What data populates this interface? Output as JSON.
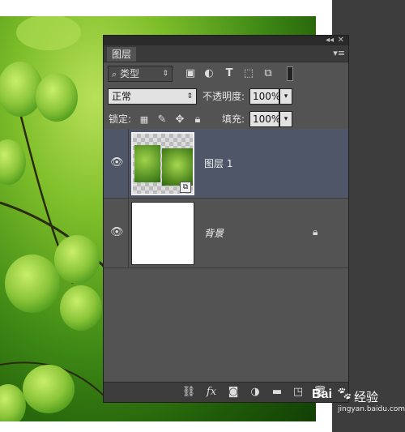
{
  "panel": {
    "tab_label": "图层",
    "filter": {
      "label": "类型",
      "search_icon": "search-icon"
    },
    "filter_icons": [
      "image-filter-icon",
      "adjustment-filter-icon",
      "type-filter-icon",
      "shape-filter-icon",
      "smart-object-filter-icon"
    ],
    "blend_mode": "正常",
    "opacity": {
      "label": "不透明度:",
      "value": "100%"
    },
    "lock": {
      "label": "锁定:"
    },
    "fill": {
      "label": "填充:",
      "value": "100%"
    },
    "layers": [
      {
        "name": "图层 1",
        "selected": true,
        "visible": true
      },
      {
        "name": "背景",
        "selected": false,
        "visible": true,
        "locked": true
      }
    ],
    "bottom_icons": [
      "link-layers-icon",
      "fx-icon",
      "mask-icon",
      "adjustment-layer-icon",
      "folder-icon",
      "new-layer-icon",
      "trash-icon"
    ]
  },
  "watermark": {
    "brand": "Bai",
    "suffix": "经验",
    "url": "jingyan.baidu.com"
  },
  "colors": {
    "panel_bg": "#535353",
    "selected_row": "#4e5667",
    "accent_dropdown": "#e2e2e2"
  }
}
